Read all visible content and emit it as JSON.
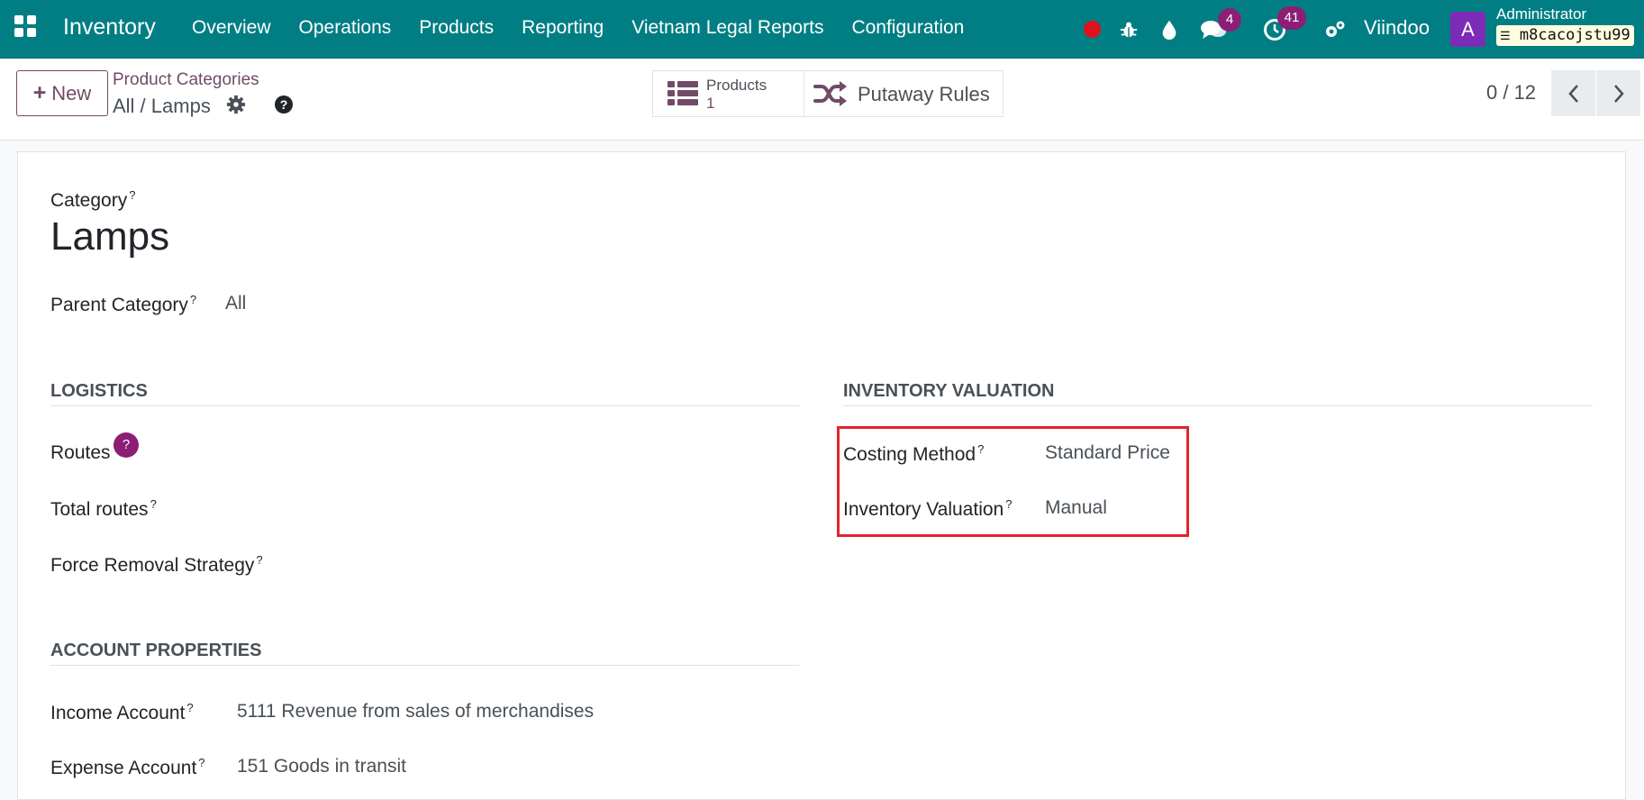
{
  "navbar": {
    "app_name": "Inventory",
    "menu": [
      "Overview",
      "Operations",
      "Products",
      "Reporting",
      "Vietnam Legal Reports",
      "Configuration"
    ],
    "messages_count": "4",
    "activities_count": "41",
    "company": "Viindoo",
    "avatar_letter": "A",
    "user_name": "Administrator",
    "database": "m8cacojstu99",
    "colors": {
      "navbar": "#017e84",
      "badge": "#8c1e76",
      "record_dot": "#e0101c",
      "avatar": "#7c2bb7"
    }
  },
  "control_panel": {
    "new_label": "New",
    "breadcrumb_parent": "Product Categories",
    "breadcrumb_current": "All / Lamps",
    "smart_buttons": {
      "products_label": "Products",
      "products_count": "1",
      "putaway_label": "Putaway Rules"
    },
    "pager": "0 / 12"
  },
  "form": {
    "category_label": "Category",
    "category_name": "Lamps",
    "parent_label": "Parent Category",
    "parent_value": "All",
    "logistics": {
      "title": "LOGISTICS",
      "routes_label": "Routes",
      "total_routes_label": "Total routes",
      "force_removal_label": "Force Removal Strategy"
    },
    "valuation": {
      "title": "INVENTORY VALUATION",
      "costing_label": "Costing Method",
      "costing_value": "Standard Price",
      "valuation_label": "Inventory Valuation",
      "valuation_value": "Manual"
    },
    "accounts": {
      "title": "ACCOUNT PROPERTIES",
      "income_label": "Income Account",
      "income_value": "5111 Revenue from sales of merchandises",
      "expense_label": "Expense Account",
      "expense_value": "151 Goods in transit"
    },
    "help_mark": "?"
  }
}
